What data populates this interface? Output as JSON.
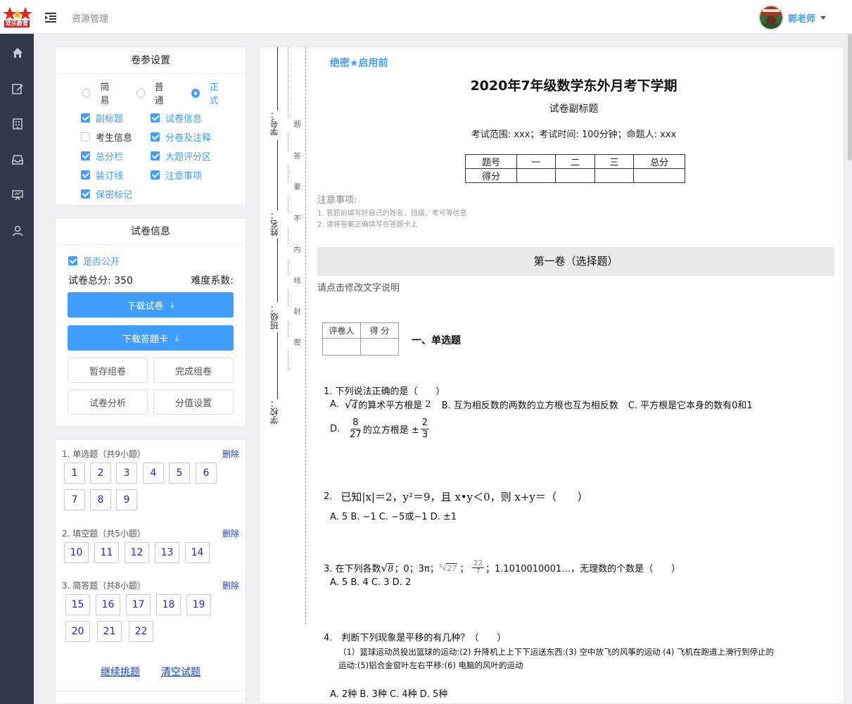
{
  "header": {
    "logo_text": "欢乐教育",
    "breadcrumb": "资源管理",
    "user_name": "郭老师"
  },
  "sidebar": {
    "icons": [
      "home-icon",
      "edit-icon",
      "building-icon",
      "inbox-icon",
      "presentation-icon",
      "user-icon"
    ]
  },
  "settings": {
    "title": "卷参设置",
    "modes": [
      {
        "label": "简易",
        "selected": false
      },
      {
        "label": "普通",
        "selected": false
      },
      {
        "label": "正式",
        "selected": true
      }
    ],
    "options": [
      {
        "label": "副标题",
        "checked": true
      },
      {
        "label": "试卷信息",
        "checked": true
      },
      {
        "label": "考生信息",
        "checked": false
      },
      {
        "label": "分卷及注释",
        "checked": true
      },
      {
        "label": "总分栏",
        "checked": true
      },
      {
        "label": "大题评分区",
        "checked": true
      },
      {
        "label": "装订线",
        "checked": true
      },
      {
        "label": "注意事项",
        "checked": true
      },
      {
        "label": "保密标记",
        "checked": true
      }
    ]
  },
  "paper_info": {
    "title": "试卷信息",
    "public_label": "是否公开",
    "public_checked": true,
    "total_label": "试卷总分: 350",
    "difficulty_label": "难度系数:",
    "download_paper": "下载试卷",
    "download_card": "下载答题卡",
    "save_draft": "暂存组卷",
    "finish": "完成组卷",
    "analysis": "试卷分析",
    "score_setting": "分值设置"
  },
  "question_list": {
    "delete_label": "删除",
    "sections": [
      {
        "title": "1. 单选题（共9小题）",
        "numbers": [
          "1",
          "2",
          "3",
          "4",
          "5",
          "6",
          "7",
          "8",
          "9"
        ]
      },
      {
        "title": "2. 填空题（共5小题）",
        "numbers": [
          "10",
          "11",
          "12",
          "13",
          "14"
        ]
      },
      {
        "title": "3. 简答题（共8小题）",
        "numbers": [
          "15",
          "16",
          "17",
          "18",
          "19",
          "20",
          "21",
          "22"
        ]
      }
    ],
    "continue_link": "继续挑题",
    "clear_link": "清空试题"
  },
  "paper": {
    "secret_tag": "绝密★启用前",
    "title": "2020年7年级数学东外月考下学期",
    "subtitle": "试卷副标题",
    "info": "考试范围: xxx；考试时间: 100分钟；命题人: xxx",
    "score_table": {
      "head": [
        "题号",
        "一",
        "二",
        "三",
        "总分"
      ],
      "row_label": "得分"
    },
    "binding_labels": [
      "学号：",
      "姓名：",
      "班级：",
      "学校："
    ],
    "seal_chars": [
      "题",
      "答",
      "要",
      "不",
      "内",
      "线",
      "封",
      "密"
    ],
    "notes_title": "注意事项:",
    "notes": [
      "1. 答题前填写好自己的姓名、班级、考号等信息",
      "2. 请将答案正确填写在答题卡上"
    ],
    "part_title": "第一卷（选择题）",
    "part_hint": "请点击修改文字说明",
    "grader_head": [
      "评卷人",
      "得 分"
    ],
    "section_title": "一、单选题",
    "questions": {
      "q1": {
        "stem": "1. 下列说法正确的是（　　）",
        "a_pre": "A.",
        "a_rad": "4",
        "a_text": "的算术平方根是",
        "a_val": "2",
        "b": "B. 互为相反数的两数的立方根也互为相反数",
        "c": "C. 平方根是它本身的数有0和1",
        "d_pre": "D.",
        "d_num": "8",
        "d_den": "27",
        "d_text": "的立方根是 ±",
        "d_num2": "2",
        "d_den2": "3"
      },
      "q2": {
        "num": "2.",
        "stem": "已知|x|＝2，y²＝9，且 x•y＜0，则 x+y＝（　　）",
        "options": "A. 5  B. −1  C. −5或−1  D. ±1"
      },
      "q3": {
        "pre": "3. 在下列各数",
        "sqrt8": "8",
        "mid": "；0；3π；",
        "cbrt": "27",
        "frac_num": "22",
        "frac_den": "7",
        "post": "；1.1010010001…，无理数的个数是（　　）",
        "options": "A. 5  B. 4  C. 3  D. 2"
      },
      "q4": {
        "stem": "4.　判断下列现象是平移的有几种？（　　）",
        "line1": "（1）篮球运动员投出篮球的运动:(2) 升降机上上下下运送东西:(3) 空中放飞的风筝的运动 (4) 飞机在跑道上滑行到停止的",
        "line2": "运动:(5)铝合金窗叶左右平移:(6) 电脑的风叶的运动",
        "options": "A. 2种  B. 3种  C. 4种  D. 5种"
      }
    }
  }
}
